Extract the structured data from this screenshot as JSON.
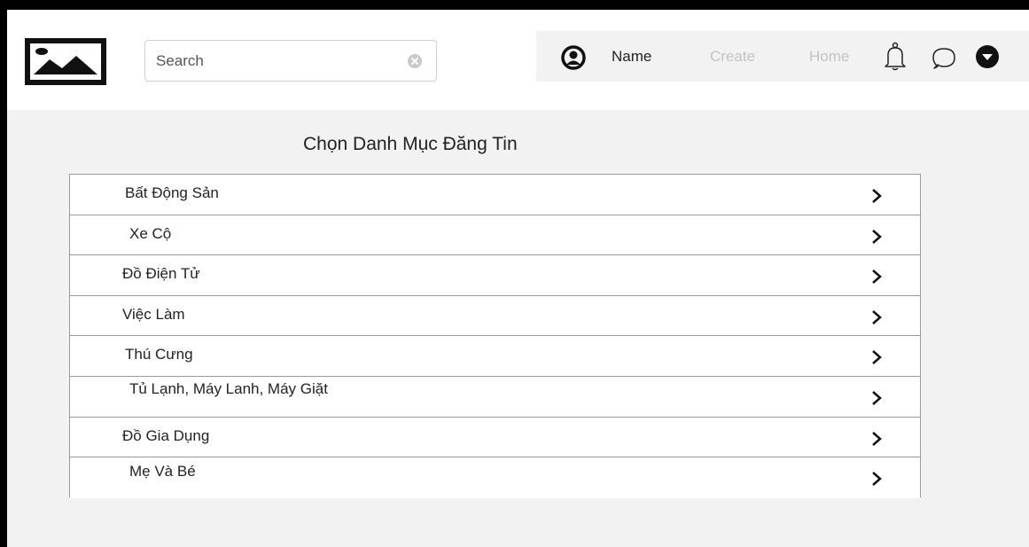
{
  "search": {
    "placeholder": "Search"
  },
  "nav": {
    "name_label": "Name",
    "create_label": "Create",
    "home_label": "Home"
  },
  "page": {
    "title": "Chọn Danh Mục Đăng Tin"
  },
  "categories": [
    {
      "label": "Bất Động Sản"
    },
    {
      "label": "Xe Cộ"
    },
    {
      "label": "Đồ Điện Tử"
    },
    {
      "label": "Việc Làm"
    },
    {
      "label": "Thú Cưng"
    },
    {
      "label": "Tủ Lạnh, Máy Lanh, Máy Giặt"
    },
    {
      "label": "Đồ Gia Dụng"
    },
    {
      "label": "Mẹ Và Bé"
    }
  ],
  "icons": {
    "logo": "image-placeholder-icon",
    "clear": "clear-circle-icon",
    "user": "user-circle-icon",
    "bell": "bell-icon",
    "chat": "chat-bubble-icon",
    "menu": "dropdown-circle-icon",
    "chevron": "chevron-right-icon"
  }
}
